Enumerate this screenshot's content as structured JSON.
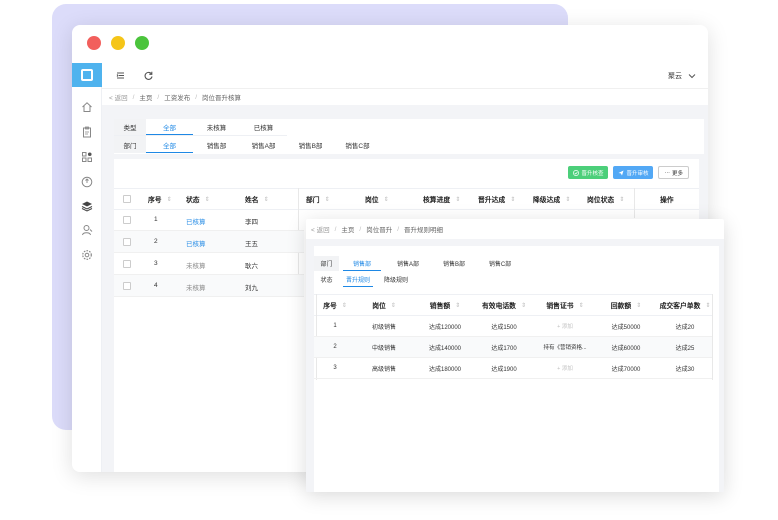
{
  "main": {
    "user_name": "聚云",
    "breadcrumb": {
      "back": "< 返回",
      "items": [
        "主页",
        "工资发布",
        "岗位晋升核算"
      ]
    },
    "filters": {
      "type_label": "类型",
      "type_options": [
        "全部",
        "未核算",
        "已核算"
      ],
      "dept_label": "部门",
      "dept_options": [
        "全部",
        "销售部",
        "销售A部",
        "销售B部",
        "销售C部"
      ]
    },
    "actions": {
      "promote_check": "晋升核查",
      "promote_approve": "晋升审核",
      "more": "更多"
    },
    "table": {
      "headers": [
        "序号",
        "状态",
        "姓名",
        "部门",
        "岗位",
        "核算进度",
        "晋升达成",
        "降级达成",
        "岗位状态",
        "操作"
      ],
      "rows": [
        {
          "no": "1",
          "status": "已核算",
          "name": "李四"
        },
        {
          "no": "2",
          "status": "已核算",
          "name": "王五"
        },
        {
          "no": "3",
          "status": "未核算",
          "name": "耿六"
        },
        {
          "no": "4",
          "status": "未核算",
          "name": "刘九"
        }
      ]
    }
  },
  "secondary": {
    "breadcrumb": {
      "back": "< 返回",
      "items": [
        "主页",
        "岗位晋升",
        "晋升规则明细"
      ]
    },
    "filters": {
      "dept_label": "部门",
      "dept_options": [
        "销售部",
        "销售A部",
        "销售B部",
        "销售C部"
      ],
      "status_label": "状态",
      "status_options": [
        "晋升规则",
        "降级规则"
      ]
    },
    "table": {
      "headers": [
        "序号",
        "岗位",
        "销售额",
        "有效电话数",
        "销售证书",
        "回款额",
        "成交客户单数"
      ],
      "rows": [
        {
          "no": "1",
          "post": "初级销售",
          "sales": "达成120000",
          "calls": "达成1500",
          "cert": "+ 添加",
          "payment": "达成50000",
          "deals": "达成20"
        },
        {
          "no": "2",
          "post": "中级销售",
          "sales": "达成140000",
          "calls": "达成1700",
          "cert": "持有《营销资格...",
          "payment": "达成60000",
          "deals": "达成25"
        },
        {
          "no": "3",
          "post": "高级销售",
          "sales": "达成180000",
          "calls": "达成1900",
          "cert": "+ 添加",
          "payment": "达成70000",
          "deals": "达成30"
        }
      ]
    }
  },
  "colors": {
    "accent": "#1e88e5",
    "logo": "#4fb3ee",
    "success": "#4ccf7a",
    "backdrop": "#dcdcfa"
  }
}
